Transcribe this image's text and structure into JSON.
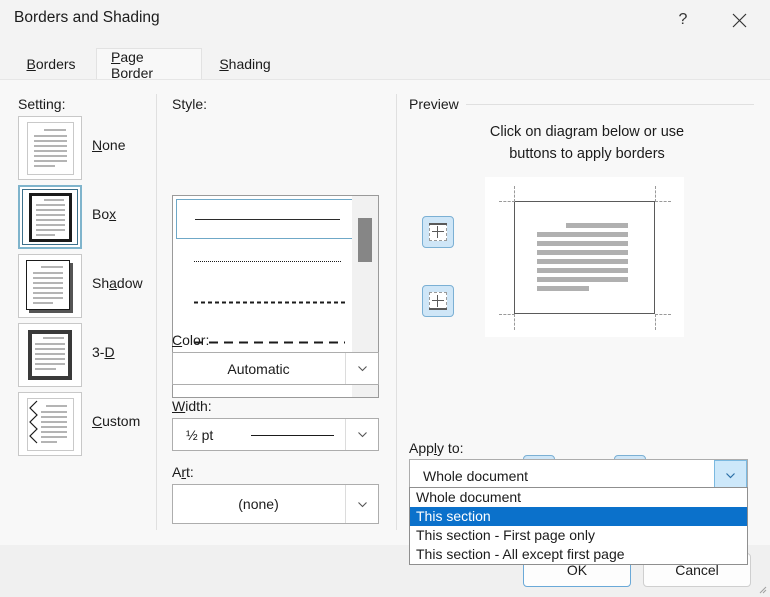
{
  "window": {
    "title": "Borders and Shading",
    "help_icon": "help-question-icon",
    "close_icon": "close-icon"
  },
  "tabs": [
    {
      "label": "Borders",
      "accel": "B",
      "active": false
    },
    {
      "label": "Page Border",
      "accel": "P",
      "active": true
    },
    {
      "label": "Shading",
      "accel": "S",
      "active": false
    }
  ],
  "setting": {
    "label": "Setting:",
    "selected": "Box",
    "options": [
      {
        "label": "None",
        "accel": "N"
      },
      {
        "label": "Box",
        "accel": "x"
      },
      {
        "label": "Shadow",
        "accel": "a"
      },
      {
        "label": "3-D",
        "accel": "D"
      },
      {
        "label": "Custom",
        "accel": "C"
      }
    ]
  },
  "style": {
    "label": "Style:",
    "selected_index": 0,
    "options": [
      {
        "name": "solid"
      },
      {
        "name": "dotted"
      },
      {
        "name": "dashed-fine"
      },
      {
        "name": "dashed-wide"
      },
      {
        "name": "dash-dot"
      }
    ]
  },
  "color": {
    "label": "Color:",
    "accel": "C",
    "value": "Automatic"
  },
  "width": {
    "label": "Width:",
    "accel": "W",
    "value": "½ pt"
  },
  "art": {
    "label": "Art:",
    "accel": "t",
    "value": "(none)"
  },
  "preview": {
    "label": "Preview",
    "hint_line1": "Click on diagram below or use",
    "hint_line2": "buttons to apply borders",
    "buttons": [
      {
        "name": "top-border-toggle"
      },
      {
        "name": "bottom-border-toggle"
      },
      {
        "name": "left-border-toggle"
      },
      {
        "name": "right-border-toggle"
      }
    ]
  },
  "apply_to": {
    "label": "Apply to:",
    "accel": "l",
    "value": "Whole document",
    "expanded": true,
    "selected_index": 1,
    "options": [
      "Whole document",
      "This section",
      "This section - First page only",
      "This section - All except first page"
    ]
  },
  "footer": {
    "ok_label": "OK",
    "cancel_label": "Cancel"
  },
  "colors": {
    "accent_selection": "#0b71cb",
    "dialog_bg": "#f8f8f8",
    "titlebar_bg": "#f3f3f3",
    "button_accent": "#6aa9d8"
  }
}
